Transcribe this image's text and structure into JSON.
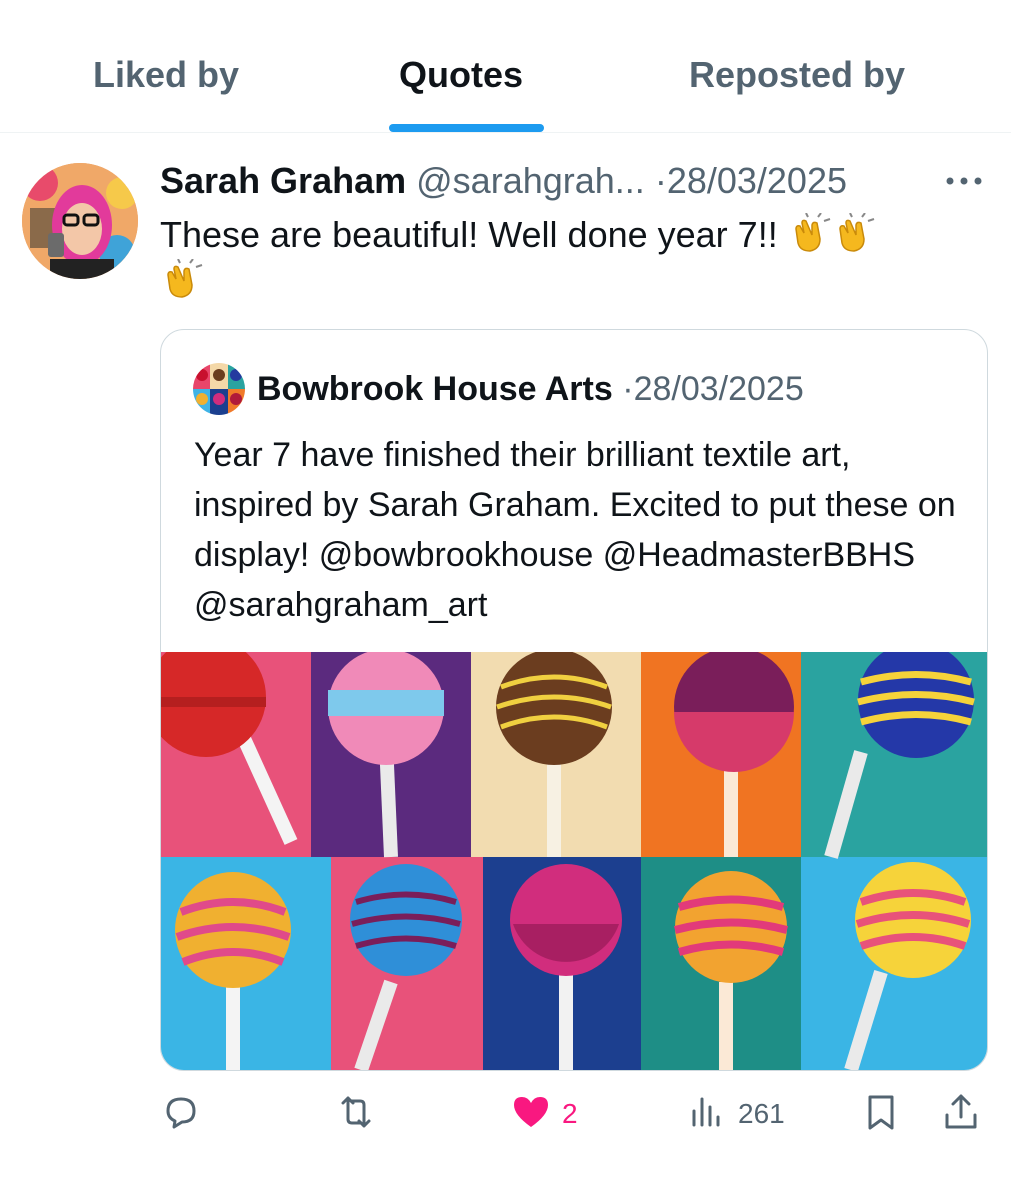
{
  "tabs": [
    {
      "label": "Liked by",
      "active": false
    },
    {
      "label": "Quotes",
      "active": true
    },
    {
      "label": "Reposted by",
      "active": false
    }
  ],
  "post": {
    "author_name": "Sarah Graham",
    "handle": "@sarahgrah...",
    "separator": "·",
    "date": "28/03/2025",
    "text": "These are beautiful! Well done year 7!!",
    "emoji_icon": "clapping-hands-icon"
  },
  "quoted_post": {
    "author_name": "Bowbrook House Arts",
    "separator": "·",
    "date": "28/03/2025",
    "text": "Year 7 have finished their brilliant textile art, inspired by Sarah Graham. Excited to put these on display! @bowbrookhouse @HeadmasterBBHS @sarahgraham_art",
    "image_icon": "lollipop-artwork-image"
  },
  "actions": {
    "reply_icon": "reply-icon",
    "repost_icon": "repost-icon",
    "like_icon": "heart-filled-icon",
    "like_count": "2",
    "views_icon": "views-icon",
    "views_count": "261",
    "bookmark_icon": "bookmark-icon",
    "share_icon": "share-icon"
  },
  "colors": {
    "accent": "#1d9bf0",
    "like": "#f91880",
    "secondary_text": "#536471",
    "primary_text": "#0f1419"
  }
}
